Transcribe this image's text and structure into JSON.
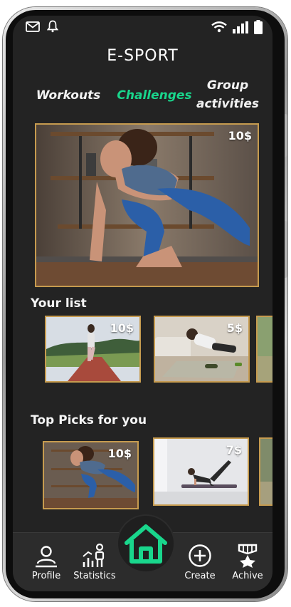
{
  "app": {
    "title": "E-SPORT"
  },
  "status_bar": {
    "icons": [
      "mail-icon",
      "bell-icon",
      "wifi-icon",
      "signal-icon",
      "battery-icon"
    ]
  },
  "tabs": [
    {
      "label": "Workouts",
      "active": false
    },
    {
      "label": "Challenges",
      "active": true
    },
    {
      "label_line1": "Group",
      "label_line2": "activities",
      "active": false
    }
  ],
  "featured": {
    "price": "10$"
  },
  "your_list": {
    "title": "Your list",
    "items": [
      {
        "price": "10$"
      },
      {
        "price": "5$"
      }
    ]
  },
  "top_picks": {
    "title": "Top Picks for you",
    "items": [
      {
        "price": "10$"
      },
      {
        "price": "7$"
      }
    ]
  },
  "nav": {
    "profile": "Profile",
    "statistics": "Statistics",
    "create": "Create",
    "achive": "Achive"
  },
  "colors": {
    "accent": "#19d68c",
    "card_border": "#c69b4f",
    "background": "#232323"
  }
}
